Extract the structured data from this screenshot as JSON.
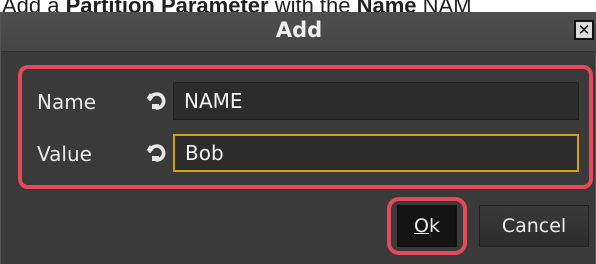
{
  "caption": {
    "prefix": "Add a ",
    "bold1": "Partition Parameter",
    "middle": " with the ",
    "bold2": "Name",
    "suffix": " NAM"
  },
  "dialog": {
    "title": "Add",
    "close_glyph": "✕"
  },
  "fields": [
    {
      "label": "Name",
      "value": "NAME",
      "icon": "reset-icon"
    },
    {
      "label": "Value",
      "value": "Bob",
      "icon": "reset-icon"
    }
  ],
  "buttons": {
    "ok_mnemonic": "O",
    "ok_rest": "k",
    "cancel": "Cancel"
  },
  "colors": {
    "highlight": "#e44a57",
    "focus_border": "#d4a019",
    "background": "#3a3a3a"
  }
}
